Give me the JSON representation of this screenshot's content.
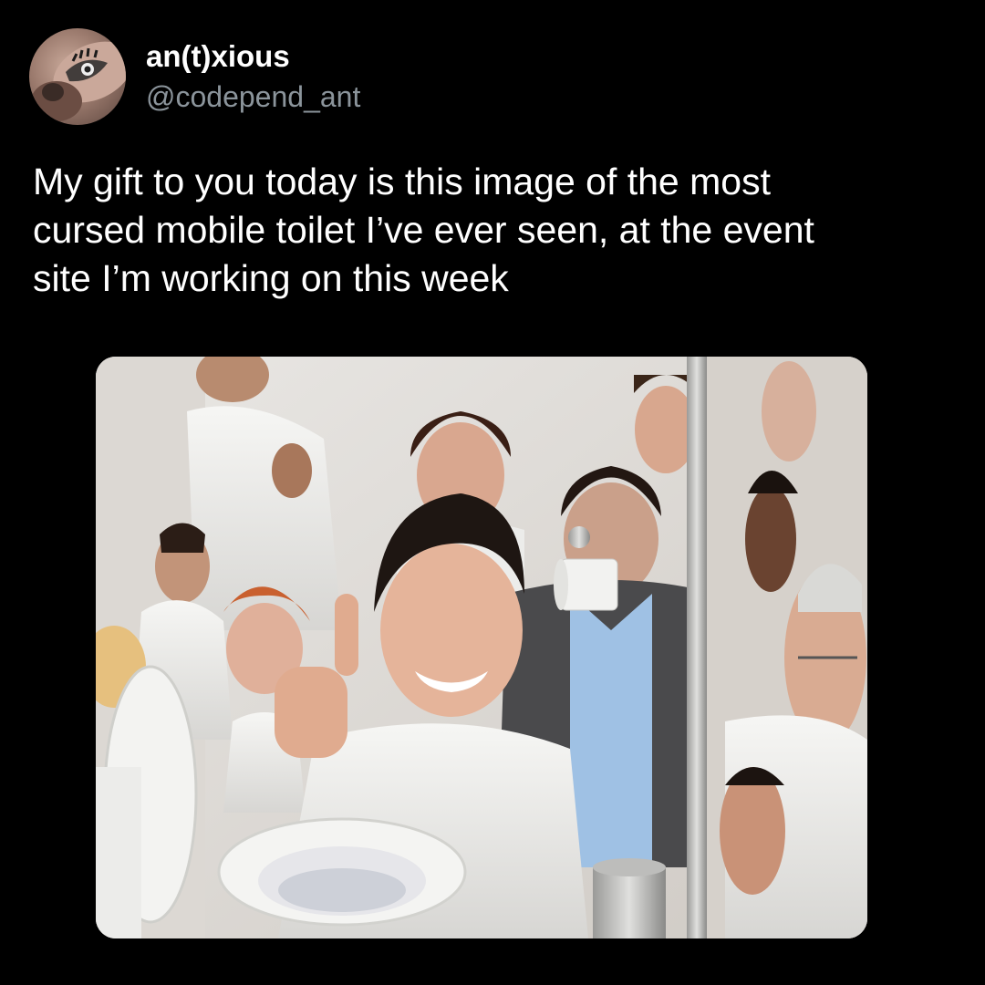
{
  "tweet": {
    "author": {
      "display_name": "an(t)xious",
      "handle": "@codepend_ant",
      "avatar_icon": "profile-photo"
    },
    "text": "My gift to you today is this image of the most\ncursed mobile toilet I’ve ever seen, at the event\nsite I’m working on this week",
    "media": {
      "kind": "photo",
      "icon": "toilet-photo"
    }
  },
  "colors": {
    "background": "#000000",
    "text": "#ffffff",
    "handle": "#8b949b"
  }
}
